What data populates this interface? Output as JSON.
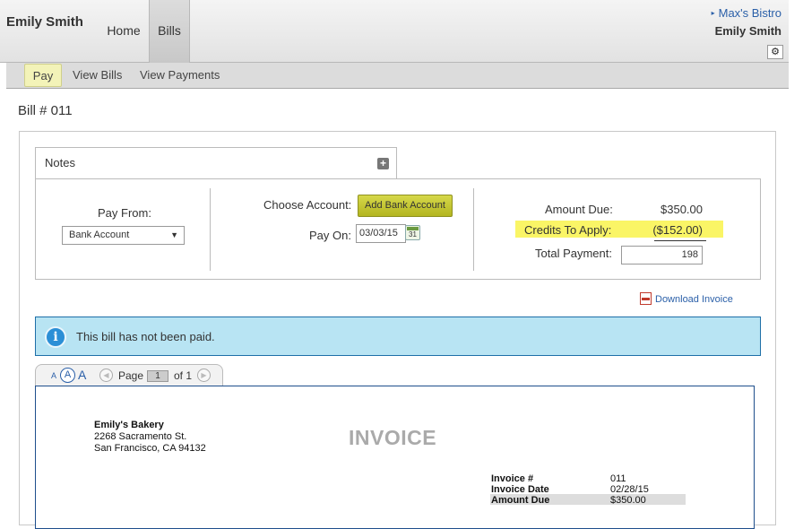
{
  "header": {
    "user_name": "Emily Smith",
    "nav": [
      {
        "label": "Home"
      },
      {
        "label": "Bills"
      }
    ],
    "business_link": "Max's Bistro",
    "user_name_right": "Emily Smith"
  },
  "subnav": [
    {
      "label": "Pay"
    },
    {
      "label": "View Bills"
    },
    {
      "label": "View Payments"
    }
  ],
  "bill_title": "Bill # 011",
  "notes": {
    "label": "Notes",
    "expand_icon": "+"
  },
  "pay_form": {
    "pay_from_label": "Pay From:",
    "pay_from_value": "Bank Account",
    "choose_account_label": "Choose Account:",
    "add_bank_button": "Add Bank Account",
    "pay_on_label": "Pay On:",
    "pay_on_value": "03/03/15",
    "amount_due_label": "Amount Due:",
    "amount_due_value": "$350.00",
    "credits_label": "Credits To Apply:",
    "credits_value": "($152.00)",
    "total_payment_label": "Total Payment:",
    "total_payment_value": "198",
    "highlight_color": "#faf566"
  },
  "download_invoice": "Download Invoice",
  "alert": {
    "message": "This bill has not been paid.",
    "icon": "i"
  },
  "viewer": {
    "font_small": "A",
    "font_medium": "A",
    "font_large": "A",
    "page_label": "Page",
    "page_current": "1",
    "page_of": "of 1"
  },
  "invoice": {
    "company": "Emily's Bakery",
    "address1": "2268 Sacramento St.",
    "address2": "San Francisco, CA 94132",
    "title": "INVOICE",
    "fields": [
      {
        "label": "Invoice #",
        "value": "011"
      },
      {
        "label": "Invoice Date",
        "value": "02/28/15"
      },
      {
        "label": "Amount Due",
        "value": "$350.00"
      }
    ]
  }
}
